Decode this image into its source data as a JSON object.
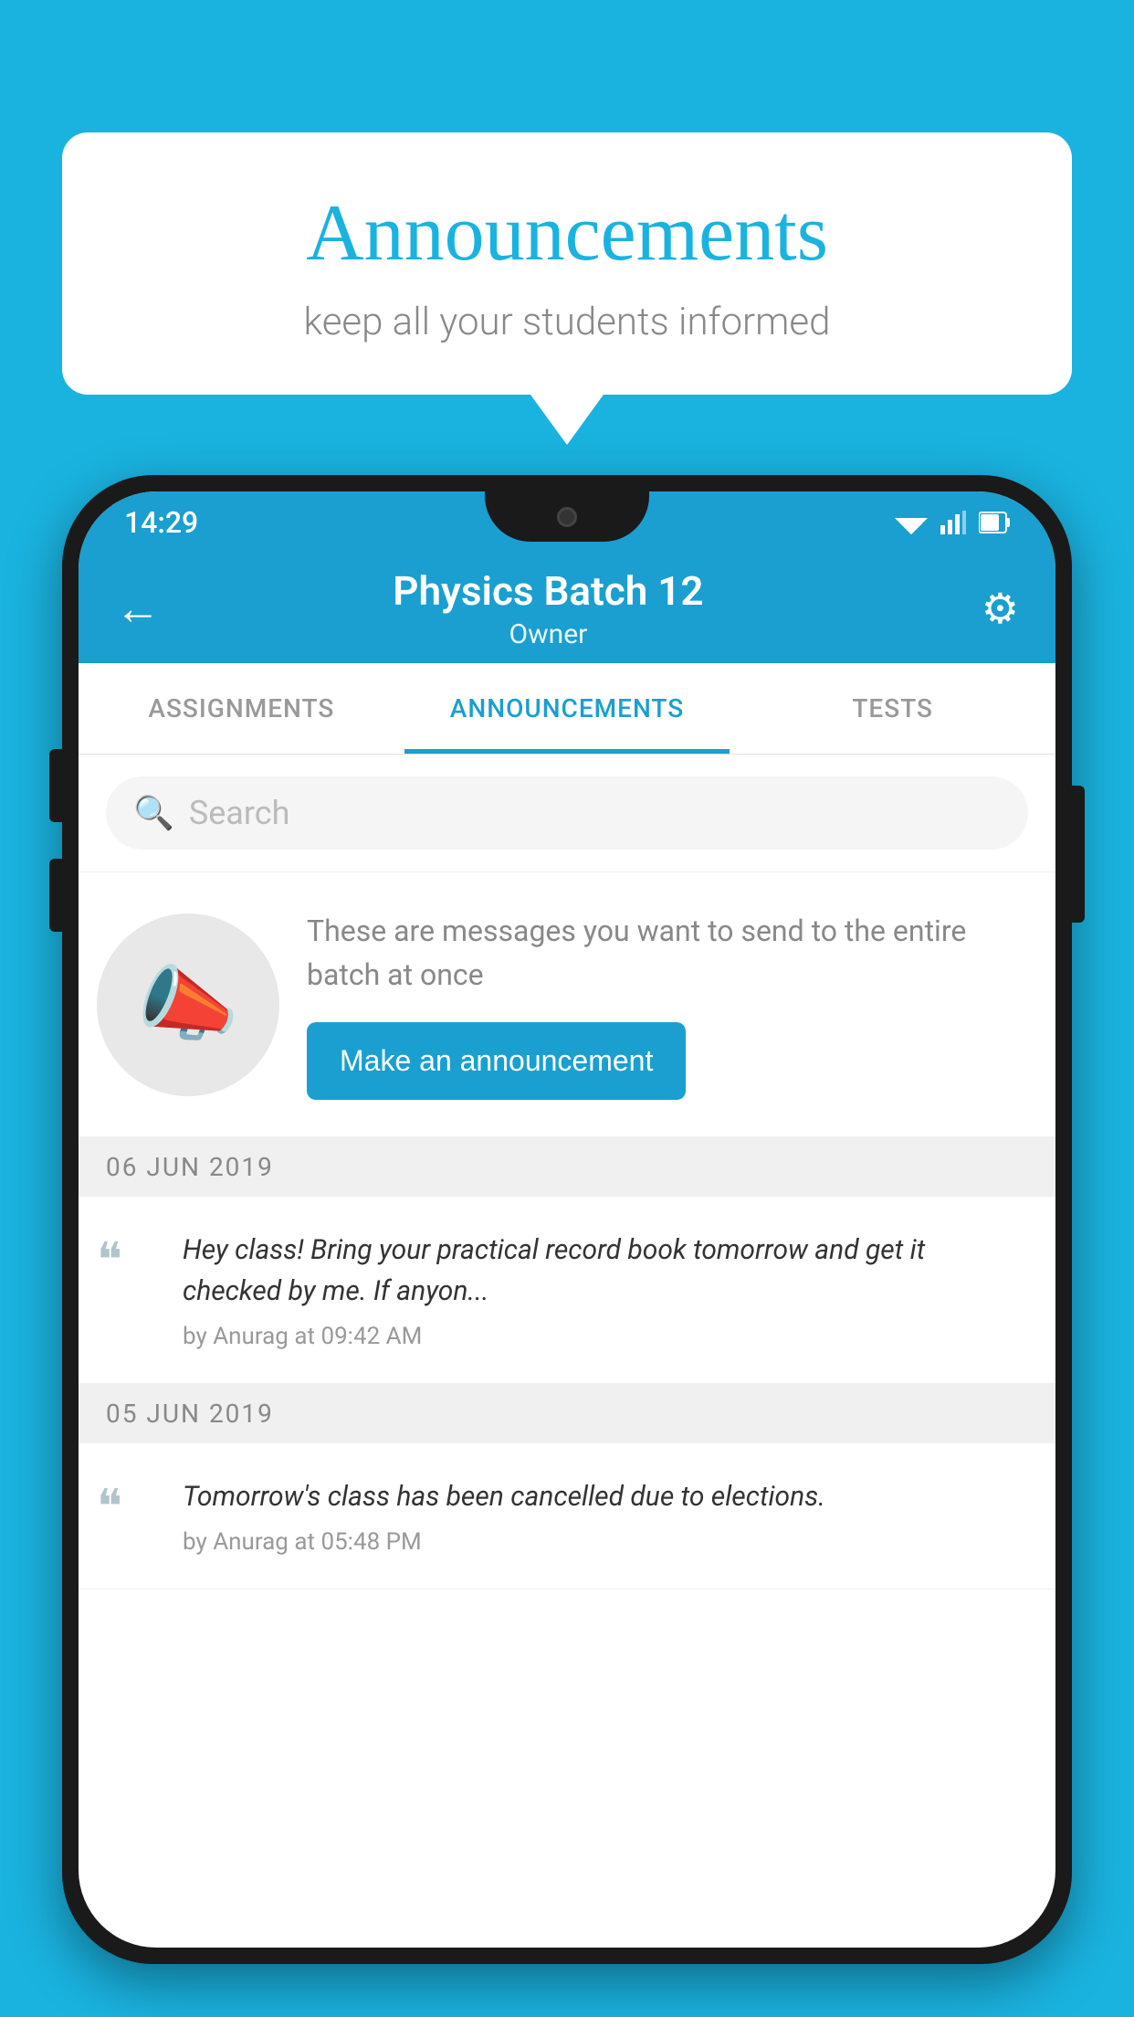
{
  "background_color": "#1ab3e0",
  "speech_bubble": {
    "title": "Announcements",
    "subtitle": "keep all your students informed"
  },
  "phone": {
    "status_bar": {
      "time": "14:29"
    },
    "app_bar": {
      "back_label": "←",
      "title": "Physics Batch 12",
      "subtitle": "Owner",
      "gear_label": "⚙"
    },
    "tabs": [
      {
        "label": "ASSIGNMENTS",
        "active": false
      },
      {
        "label": "ANNOUNCEMENTS",
        "active": true
      },
      {
        "label": "TESTS",
        "active": false
      },
      {
        "label": "...",
        "active": false
      }
    ],
    "search": {
      "placeholder": "Search"
    },
    "promo": {
      "description": "These are messages you want to send to the entire batch at once",
      "button_label": "Make an announcement"
    },
    "announcements": [
      {
        "date": "06  JUN  2019",
        "text": "Hey class! Bring your practical record book tomorrow and get it checked by me. If anyon...",
        "meta": "by Anurag at 09:42 AM"
      },
      {
        "date": "05  JUN  2019",
        "text": "Tomorrow's class has been cancelled due to elections.",
        "meta": "by Anurag at 05:48 PM"
      }
    ]
  }
}
